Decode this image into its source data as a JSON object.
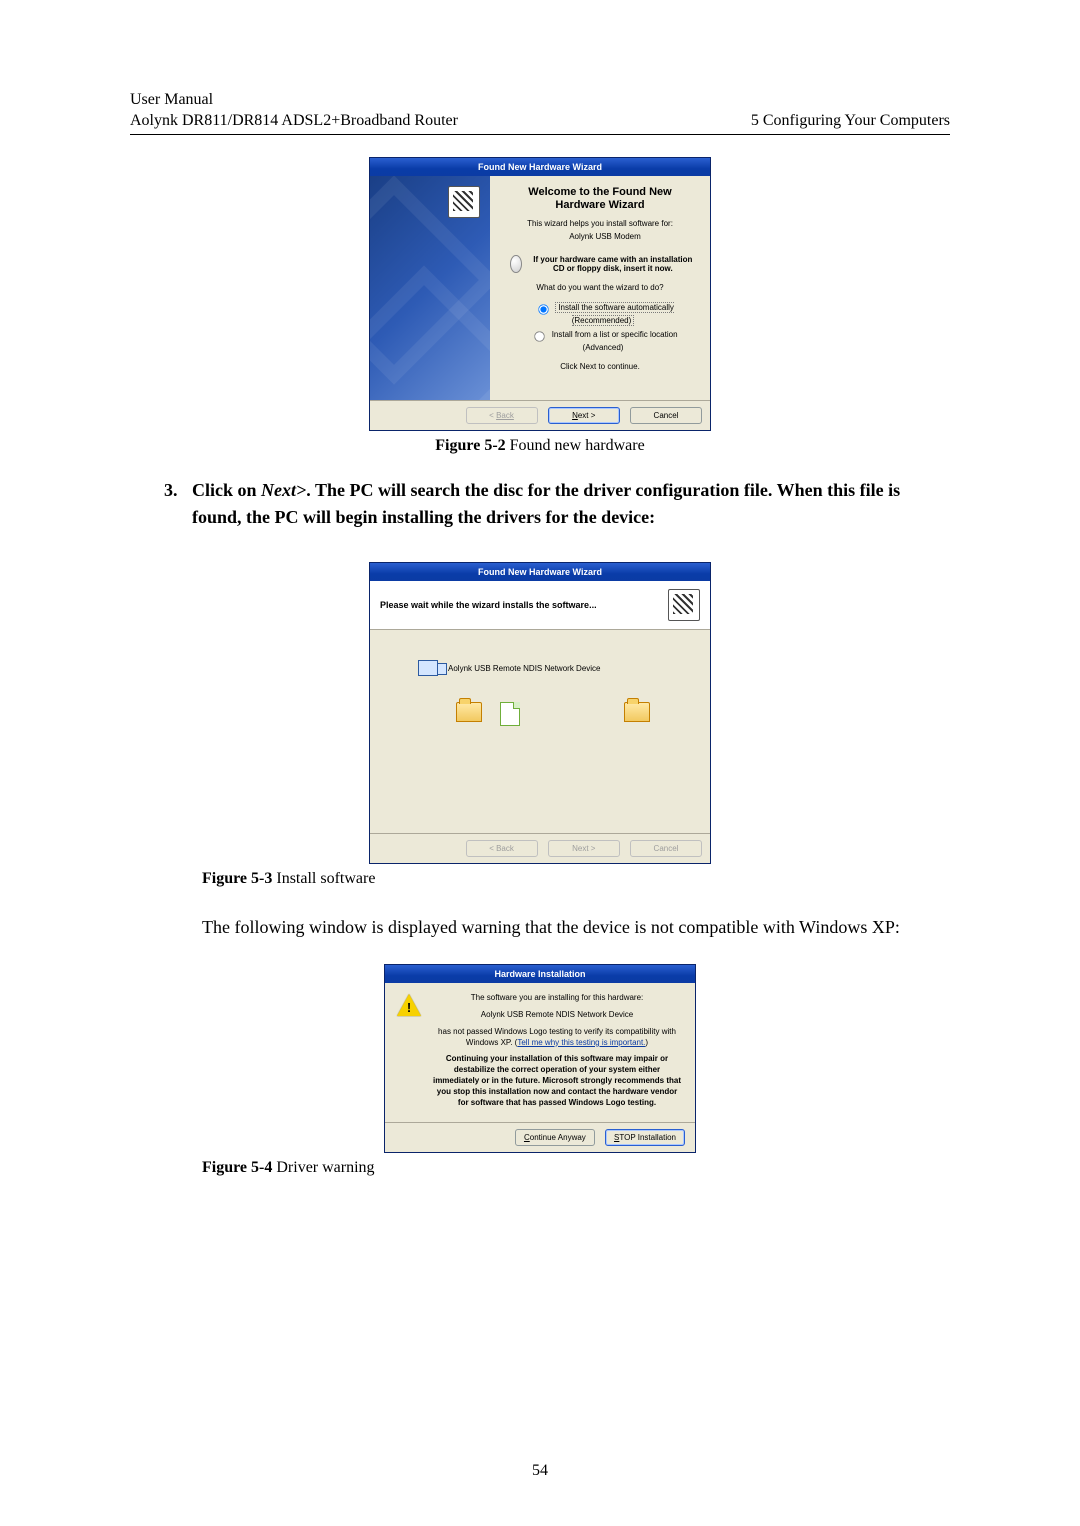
{
  "header": {
    "line1": "User Manual",
    "line2_left": "Aolynk DR811/DR814 ADSL2+Broadband Router",
    "line2_right": "5  Configuring Your Computers"
  },
  "wizard": {
    "title": "Found New Hardware Wizard",
    "heading": "Welcome to the Found New Hardware Wizard",
    "intro": "This wizard helps you install software for:",
    "device": "Aolynk USB Modem",
    "cd_hint": "If your hardware came with an installation CD or floppy disk, insert it now.",
    "question": "What do you want the wizard to do?",
    "opt_auto": "Install the software automatically (Recommended)",
    "opt_list": "Install from a list or specific location (Advanced)",
    "continue": "Click Next to continue.",
    "back": "Back",
    "next": "Next >",
    "cancel": "Cancel"
  },
  "fig2": {
    "label": "Figure 5-2",
    "text": " Found new hardware"
  },
  "step3": {
    "num": "3.",
    "text_before": "Click on ",
    "next": "Next>",
    "text_after": ". The PC will search the disc for the driver configuration file. When this file is found, the PC will begin installing the drivers for the device:"
  },
  "install": {
    "title": "Found New Hardware Wizard",
    "heading": "Please wait while the wizard installs the software...",
    "device": "Aolynk USB Remote NDIS Network Device",
    "back": "< Back",
    "next": "Next >",
    "cancel": "Cancel"
  },
  "fig3": {
    "label": "Figure 5-3",
    "text": " Install software"
  },
  "para_compat": "The following window is displayed warning that the device is not compatible with Windows XP:",
  "warn": {
    "title": "Hardware Installation",
    "l1": "The software you are installing for this hardware:",
    "device": "Aolynk USB Remote NDIS Network Device",
    "l2a": "has not passed Windows Logo testing to verify its compatibility with Windows XP. (",
    "link": "Tell me why this testing is important.",
    "l2b": ")",
    "bold": "Continuing your installation of this software may impair or destabilize the correct operation of your system either immediately or in the future. Microsoft strongly recommends that you stop this installation now and contact the hardware vendor for software that has passed Windows Logo testing.",
    "continue": "Continue Anyway",
    "stop": "STOP Installation"
  },
  "fig4": {
    "label": "Figure 5-4",
    "text": " Driver warning"
  },
  "page_number": "54"
}
